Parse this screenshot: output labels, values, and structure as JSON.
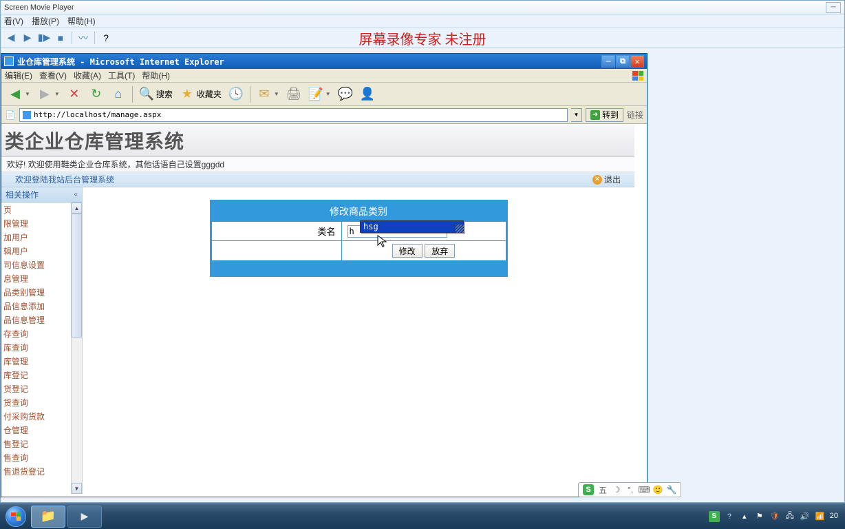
{
  "smp": {
    "title": "Screen Movie Player",
    "menus": [
      "看(V)",
      "播放(P)",
      "帮助(H)"
    ],
    "watermark": "屏幕录像专家  未注册"
  },
  "ie": {
    "title": "业仓库管理系统 - Microsoft Internet Explorer",
    "menus": [
      "编辑(E)",
      "查看(V)",
      "收藏(A)",
      "工具(T)",
      "帮助(H)"
    ],
    "toolbar": {
      "search": "搜索",
      "favorites": "收藏夹"
    },
    "address": "http://localhost/manage.aspx",
    "go": "转到",
    "links": "链接"
  },
  "page": {
    "banner_title": "类企业仓库管理系统",
    "welcome_text": "欢好! 欢迎使用鞋类企业仓库系统，其他话语自己设置gggdd",
    "welcome_bar": "欢迎登陆我站后台管理系统",
    "exit": "退出"
  },
  "sidebar": {
    "header": "相关操作",
    "items": [
      "页",
      "限管理",
      "加用户",
      "辑用户",
      "司信息设置",
      "息管理",
      "品类别管理",
      "品信息添加",
      "品信息管理",
      "存查询",
      "库查询",
      "库管理",
      "库登记",
      "货登记",
      "货查询",
      "付采购货款",
      "仓管理",
      "售登记",
      "售查询",
      "售退货登记"
    ]
  },
  "form": {
    "title": "修改商品类别",
    "label_name": "类名",
    "input_value": "h",
    "btn_submit": "修改",
    "btn_cancel": "放弃"
  },
  "autocomplete": {
    "suggestion": "hsg"
  },
  "ime": {
    "label": "五"
  },
  "taskbar": {
    "time": "20"
  }
}
